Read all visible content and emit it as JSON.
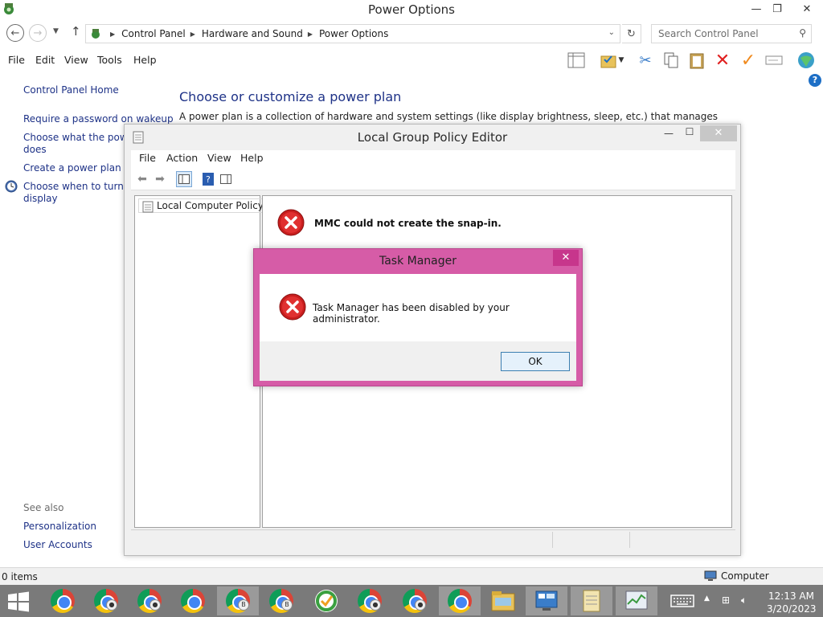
{
  "control_panel": {
    "title": "Power Options",
    "breadcrumb": [
      "Control Panel",
      "Hardware and Sound",
      "Power Options"
    ],
    "search_placeholder": "Search Control Panel",
    "menu": [
      "File",
      "Edit",
      "View",
      "Tools",
      "Help"
    ],
    "toolbar_icons": [
      "layout-icon",
      "folder-check-icon",
      "cut-icon",
      "copy-icon",
      "paste-icon",
      "delete-icon",
      "checkmark-icon",
      "rename-icon",
      "globe-icon"
    ],
    "left_links": {
      "home": "Control Panel Home",
      "password": "Require a password on wakeup",
      "power_button_1": "Choose what the power",
      "power_button_2": "does",
      "create_plan": "Create a power plan",
      "turn_off_1": "Choose when to turn of",
      "turn_off_2": "display"
    },
    "see_also": "See also",
    "see_also_links": {
      "personalization": "Personalization",
      "user_accounts": "User Accounts"
    },
    "heading": "Choose or customize a power plan",
    "description": "A power plan is a collection of hardware and system settings (like display brightness, sleep, etc.) that manages",
    "status_items": "0 items",
    "status_location": "Computer"
  },
  "gpe": {
    "title": "Local Group Policy Editor",
    "menu": [
      "File",
      "Action",
      "View",
      "Help"
    ],
    "tree_item": "Local Computer Policy",
    "error_text": "MMC could not create the snap-in."
  },
  "task_manager": {
    "title": "Task Manager",
    "message": "Task Manager has been disabled by your administrator.",
    "ok_label": "OK",
    "accent_color": "#d65ca7"
  },
  "taskbar": {
    "time": "12:13 AM",
    "date": "3/20/2023"
  }
}
